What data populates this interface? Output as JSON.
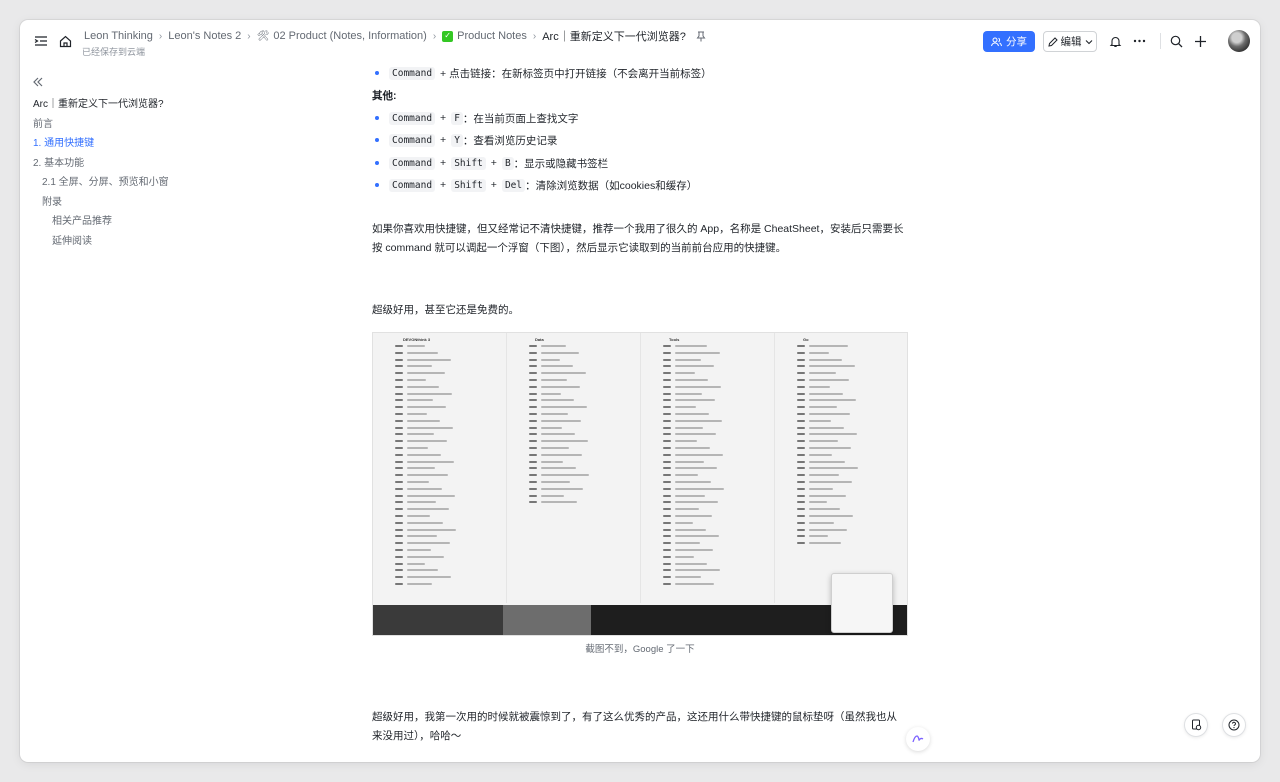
{
  "breadcrumb": {
    "items": [
      {
        "label": "Leon Thinking",
        "icon": ""
      },
      {
        "label": "Leon's Notes 2",
        "icon": ""
      },
      {
        "label": "02 Product (Notes, Information)",
        "icon": "🛠"
      },
      {
        "label": "Product Notes",
        "icon": "✓"
      },
      {
        "label": "Arc｜重新定义下一代浏览器?",
        "icon": ""
      }
    ],
    "save_status": "已经保存到云端"
  },
  "toolbar": {
    "share_label": "分享",
    "edit_label": "编辑",
    "accent_color": "#3370ff"
  },
  "toc": {
    "title": "Arc｜重新定义下一代浏览器?",
    "items": [
      {
        "label": "前言",
        "level": 1,
        "active": false
      },
      {
        "label": "1. 通用快捷键",
        "level": 1,
        "active": true
      },
      {
        "label": "2. 基本功能",
        "level": 1,
        "active": false
      },
      {
        "label": "2.1 全屏、分屏、预览和小窗",
        "level": 2,
        "active": false
      },
      {
        "label": "附录",
        "level": 2,
        "active": false
      },
      {
        "label": "相关产品推荐",
        "level": 3,
        "active": false
      },
      {
        "label": "延伸阅读",
        "level": 3,
        "active": false
      }
    ]
  },
  "content": {
    "item0": {
      "keys": [
        "Command"
      ],
      "text": "+ 点击链接：在新标签页中打开链接（不会离开当前标签）"
    },
    "others_heading": "其他:",
    "item1": {
      "k1": "Command",
      "k2": "F",
      "text": "：在当前页面上查找文字"
    },
    "item2": {
      "k1": "Command",
      "k2": "Y",
      "text": "：查看浏览历史记录"
    },
    "item3": {
      "k1": "Command",
      "k2": "Shift",
      "k3": "B",
      "text": "：显示或隐藏书签栏"
    },
    "item4": {
      "k1": "Command",
      "k2": "Shift",
      "k3": "Del",
      "text": "：清除浏览数据（如cookies和缓存）"
    },
    "para1": "如果你喜欢用快捷键，但又经常记不清快捷键，推荐一个我用了很久的 App，名称是 CheatSheet，安装后只需要长按 command 就可以调起一个浮窗（下图），然后显示它读取到的当前前台应用的快捷键。",
    "para2": "超级好用，甚至它还是免费的。",
    "figure": {
      "col_titles": [
        "DEVONthink 3",
        "Data",
        "Tools",
        "Go"
      ],
      "caption": "截图不到，Google 了一下"
    },
    "para3": "超级好用，我第一次用的时候就被震惊到了，有了这么优秀的产品，这还用什么带快捷键的鼠标垫呀（虽然我也从来没用过），哈哈～"
  }
}
